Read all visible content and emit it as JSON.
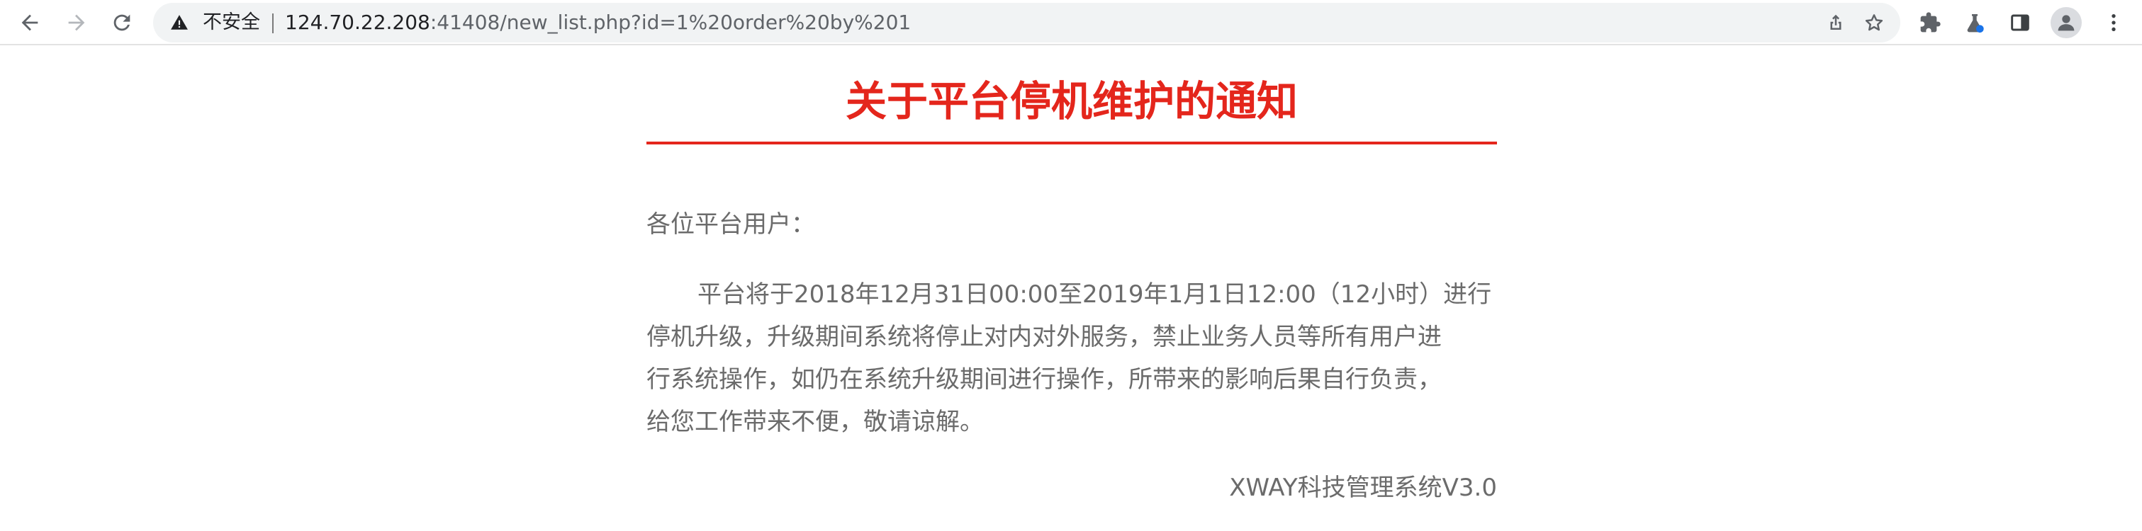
{
  "browser": {
    "security_label": "不安全",
    "url_host": "124.70.22.208",
    "url_rest": ":41408/new_list.php?id=1%20order%20by%201",
    "icons": {
      "back": "back-arrow-icon",
      "forward": "forward-arrow-icon",
      "reload": "reload-icon",
      "warning": "warning-triangle-icon",
      "share": "share-icon",
      "bookmark": "star-icon",
      "extensions": "puzzle-icon",
      "labs": "flask-icon",
      "side_panel": "side-panel-icon",
      "profile": "avatar-icon",
      "menu": "kebab-menu-icon"
    }
  },
  "notice": {
    "title": "关于平台停机维护的通知",
    "greeting": "各位平台用户：",
    "body_lines": [
      "平台将于2018年12月31日00:00至2019年1月1日12:00（12小时）进行",
      "停机升级，升级期间系统将停止对内对外服务，禁止业务人员等所有用户进",
      "行系统操作，如仍在系统升级期间进行操作，所带来的影响后果自行负责，",
      "给您工作带来不便，敬请谅解。"
    ],
    "signature": "XWAY科技管理系统V3.0"
  },
  "colors": {
    "accent": "#e4261c",
    "body_text": "#6b6b6b",
    "omnibox_bg": "#f1f3f4"
  }
}
